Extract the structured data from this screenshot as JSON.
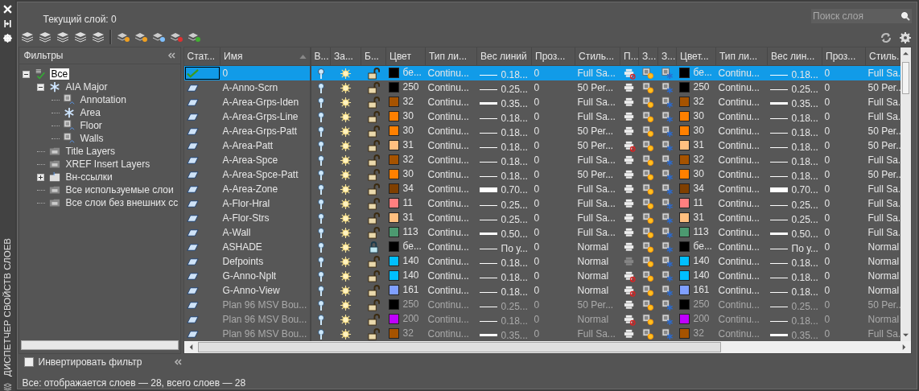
{
  "palette_title": "ДИСПЕТЧЕР СВОЙСТВ СЛОЕВ",
  "current_layer": "Текущий слой: 0",
  "search": {
    "placeholder": "Поиск слоя"
  },
  "filters": {
    "title": "Фильтры",
    "tree": [
      {
        "label": "Все",
        "kind": "all",
        "selected": true,
        "expanded": true,
        "children": [
          {
            "label": "AIA Major",
            "kind": "group",
            "selected": false,
            "expanded": true,
            "children": [
              {
                "label": "Annotation",
                "kind": "property",
                "selected": false
              },
              {
                "label": "Area",
                "kind": "group",
                "selected": false
              },
              {
                "label": "Floor",
                "kind": "property",
                "selected": false
              },
              {
                "label": "Walls",
                "kind": "property",
                "selected": false
              }
            ]
          },
          {
            "label": "Title Layers",
            "kind": "folder",
            "selected": false
          },
          {
            "label": "XREF Insert Layers",
            "kind": "folder",
            "selected": false
          },
          {
            "label": "Вн-ссылки",
            "kind": "xref",
            "selected": false,
            "expanded": false
          },
          {
            "label": "Все используемые слои",
            "kind": "folder",
            "selected": false
          },
          {
            "label": "Все слои без внешних сс",
            "kind": "folder",
            "selected": false
          }
        ]
      }
    ],
    "invert": {
      "label": "Инвертировать фильтр",
      "checked": false
    }
  },
  "table": {
    "columns": [
      "Стат...",
      "Имя",
      "В...",
      "За...",
      "Б...",
      "Цвет",
      "Тип ли...",
      "Вес линий",
      "Проз...",
      "Стиль...",
      "П...",
      "З...",
      "З...",
      "Цвет...",
      "Тип ли...",
      "Вес лин...",
      "Проз...",
      "Стиль."
    ],
    "rows": [
      {
        "name": "0",
        "kind": "thin",
        "selected": true,
        "current": true,
        "dimmed": false,
        "on": true,
        "frozen": false,
        "locked": false,
        "color": "#000000",
        "color_name": "бе...",
        "linetype": "Continu...",
        "lineweight": "0.18...",
        "transparency": "0",
        "plot_style": "Full Sa...",
        "plot": false,
        "plot_disabled": false,
        "vp_color_name": "бе...",
        "vp_linetype": "Continu...",
        "vp_lineweight": "0.18...",
        "vp_transparency": "0",
        "vp_plot_style": "Full Sa."
      },
      {
        "name": "A-Anno-Scrn",
        "kind": "thin",
        "selected": false,
        "current": false,
        "dimmed": false,
        "on": true,
        "frozen": false,
        "locked": false,
        "color": "#000000",
        "color_name": "250",
        "linetype": "Continu...",
        "lineweight": "0.25...",
        "transparency": "0",
        "plot_style": "50 Per...",
        "plot": true,
        "plot_disabled": false,
        "vp_color_name": "250",
        "vp_linetype": "Continu...",
        "vp_lineweight": "0.25...",
        "vp_transparency": "0",
        "vp_plot_style": "50 Per.."
      },
      {
        "name": "A-Area-Grps-Iden",
        "kind": "bold",
        "selected": false,
        "current": false,
        "dimmed": false,
        "on": true,
        "frozen": false,
        "locked": false,
        "color": "#a65300",
        "color_name": "32",
        "linetype": "Continu...",
        "lineweight": "0.35...",
        "transparency": "0",
        "plot_style": "Full Sa...",
        "plot": true,
        "plot_disabled": false,
        "vp_color_name": "32",
        "vp_linetype": "Continu...",
        "vp_lineweight": "0.35...",
        "vp_transparency": "0",
        "vp_plot_style": "Full Sa."
      },
      {
        "name": "A-Area-Grps-Line",
        "kind": "thin",
        "selected": false,
        "current": false,
        "dimmed": false,
        "on": true,
        "frozen": false,
        "locked": false,
        "color": "#ff8000",
        "color_name": "30",
        "linetype": "Continu...",
        "lineweight": "0.18...",
        "transparency": "0",
        "plot_style": "Full Sa...",
        "plot": true,
        "plot_disabled": false,
        "vp_color_name": "30",
        "vp_linetype": "Continu...",
        "vp_lineweight": "0.18...",
        "vp_transparency": "0",
        "vp_plot_style": "Full Sa."
      },
      {
        "name": "A-Area-Grps-Patt",
        "kind": "thin",
        "selected": false,
        "current": false,
        "dimmed": false,
        "on": true,
        "frozen": false,
        "locked": false,
        "color": "#ff8000",
        "color_name": "30",
        "linetype": "Continu...",
        "lineweight": "0.18...",
        "transparency": "0",
        "plot_style": "50 Per...",
        "plot": true,
        "plot_disabled": false,
        "vp_color_name": "30",
        "vp_linetype": "Continu...",
        "vp_lineweight": "0.18...",
        "vp_transparency": "0",
        "vp_plot_style": "50 Per.."
      },
      {
        "name": "A-Area-Patt",
        "kind": "thin",
        "selected": false,
        "current": false,
        "dimmed": false,
        "on": true,
        "frozen": false,
        "locked": false,
        "color": "#ffbf80",
        "color_name": "31",
        "linetype": "Continu...",
        "lineweight": "0.18...",
        "transparency": "0",
        "plot_style": "50 Per...",
        "plot": false,
        "plot_disabled": false,
        "vp_color_name": "31",
        "vp_linetype": "Continu...",
        "vp_lineweight": "0.18...",
        "vp_transparency": "0",
        "vp_plot_style": "50 Per.."
      },
      {
        "name": "A-Area-Spce",
        "kind": "thin",
        "selected": false,
        "current": false,
        "dimmed": false,
        "on": true,
        "frozen": false,
        "locked": false,
        "color": "#a65300",
        "color_name": "32",
        "linetype": "Continu...",
        "lineweight": "0.18...",
        "transparency": "0",
        "plot_style": "Full Sa...",
        "plot": true,
        "plot_disabled": false,
        "vp_color_name": "32",
        "vp_linetype": "Continu...",
        "vp_lineweight": "0.18...",
        "vp_transparency": "0",
        "vp_plot_style": "Full Sa."
      },
      {
        "name": "A-Area-Spce-Patt",
        "kind": "thin",
        "selected": false,
        "current": false,
        "dimmed": false,
        "on": true,
        "frozen": false,
        "locked": false,
        "color": "#ff8000",
        "color_name": "30",
        "linetype": "Continu...",
        "lineweight": "0.18...",
        "transparency": "0",
        "plot_style": "50 Per...",
        "plot": true,
        "plot_disabled": false,
        "vp_color_name": "30",
        "vp_linetype": "Continu...",
        "vp_lineweight": "0.18...",
        "vp_transparency": "0",
        "vp_plot_style": "50 Per.."
      },
      {
        "name": "A-Area-Zone",
        "kind": "heavy",
        "selected": false,
        "current": false,
        "dimmed": false,
        "on": true,
        "frozen": false,
        "locked": false,
        "color": "#7f3f00",
        "color_name": "34",
        "linetype": "Continu...",
        "lineweight": "0.70...",
        "transparency": "0",
        "plot_style": "Full Sa...",
        "plot": true,
        "plot_disabled": false,
        "vp_color_name": "34",
        "vp_linetype": "Continu...",
        "vp_lineweight": "0.70...",
        "vp_transparency": "0",
        "vp_plot_style": "Full Sa."
      },
      {
        "name": "A-Flor-Hral",
        "kind": "thin",
        "selected": false,
        "current": false,
        "dimmed": false,
        "on": true,
        "frozen": false,
        "locked": false,
        "color": "#ff7f7f",
        "color_name": "11",
        "linetype": "Continu...",
        "lineweight": "0.25...",
        "transparency": "0",
        "plot_style": "Full Sa...",
        "plot": true,
        "plot_disabled": false,
        "vp_color_name": "11",
        "vp_linetype": "Continu...",
        "vp_lineweight": "0.25...",
        "vp_transparency": "0",
        "vp_plot_style": "Full Sa."
      },
      {
        "name": "A-Flor-Strs",
        "kind": "thin",
        "selected": false,
        "current": false,
        "dimmed": false,
        "on": true,
        "frozen": false,
        "locked": false,
        "color": "#ffbf7f",
        "color_name": "31",
        "linetype": "Continu...",
        "lineweight": "0.25...",
        "transparency": "0",
        "plot_style": "Full Sa...",
        "plot": true,
        "plot_disabled": false,
        "vp_color_name": "31",
        "vp_linetype": "Continu...",
        "vp_lineweight": "0.25...",
        "vp_transparency": "0",
        "vp_plot_style": "Full Sa."
      },
      {
        "name": "A-Wall",
        "kind": "bold",
        "selected": false,
        "current": false,
        "dimmed": false,
        "on": true,
        "frozen": false,
        "locked": false,
        "color": "#4c9970",
        "color_name": "113",
        "linetype": "Continu...",
        "lineweight": "0.50...",
        "transparency": "0",
        "plot_style": "Full Sa...",
        "plot": true,
        "plot_disabled": false,
        "vp_color_name": "113",
        "vp_linetype": "Continu...",
        "vp_lineweight": "0.50...",
        "vp_transparency": "0",
        "vp_plot_style": "Full Sa."
      },
      {
        "name": "ASHADE",
        "kind": "thin",
        "selected": false,
        "current": false,
        "dimmed": false,
        "on": true,
        "frozen": false,
        "locked": true,
        "color": "#000000",
        "color_name": "бе...",
        "linetype": "Continu...",
        "lineweight": "По у...",
        "transparency": "0",
        "plot_style": "Normal",
        "plot": true,
        "plot_disabled": false,
        "vp_color_name": "бе...",
        "vp_linetype": "Continu...",
        "vp_lineweight": "По у...",
        "vp_transparency": "0",
        "vp_plot_style": "Normal"
      },
      {
        "name": "Defpoints",
        "kind": "thin",
        "selected": false,
        "current": false,
        "dimmed": false,
        "on": true,
        "frozen": false,
        "locked": false,
        "color": "#00bfff",
        "color_name": "140",
        "linetype": "Continu...",
        "lineweight": "0.18...",
        "transparency": "0",
        "plot_style": "Normal",
        "plot": false,
        "plot_disabled": true,
        "vp_color_name": "140",
        "vp_linetype": "Continu...",
        "vp_lineweight": "0.18...",
        "vp_transparency": "0",
        "vp_plot_style": "Normal"
      },
      {
        "name": "G-Anno-Nplt",
        "kind": "thin",
        "selected": false,
        "current": false,
        "dimmed": false,
        "on": true,
        "frozen": false,
        "locked": false,
        "color": "#00bfff",
        "color_name": "140",
        "linetype": "Continu...",
        "lineweight": "0.18...",
        "transparency": "0",
        "plot_style": "Normal",
        "plot": false,
        "plot_disabled": false,
        "vp_color_name": "140",
        "vp_linetype": "Continu...",
        "vp_lineweight": "0.18...",
        "vp_transparency": "0",
        "vp_plot_style": "Normal"
      },
      {
        "name": "G-Anno-View",
        "kind": "thin",
        "selected": false,
        "current": false,
        "dimmed": false,
        "on": true,
        "frozen": false,
        "locked": false,
        "color": "#7f9fff",
        "color_name": "161",
        "linetype": "Continu...",
        "lineweight": "0.18...",
        "transparency": "0",
        "plot_style": "Normal",
        "plot": false,
        "plot_disabled": false,
        "vp_color_name": "161",
        "vp_linetype": "Continu...",
        "vp_lineweight": "0.18...",
        "vp_transparency": "0",
        "vp_plot_style": "Normal"
      },
      {
        "name": "Plan 96 MSV Bou...",
        "kind": "thin",
        "selected": false,
        "current": false,
        "dimmed": true,
        "on": true,
        "frozen": false,
        "locked": false,
        "color": "#000000",
        "color_name": "250",
        "linetype": "Continu...",
        "lineweight": "0.25...",
        "transparency": "0",
        "plot_style": "50 Per...",
        "plot": true,
        "plot_disabled": false,
        "vp_color_name": "250",
        "vp_linetype": "Continu...",
        "vp_lineweight": "0.25...",
        "vp_transparency": "0",
        "vp_plot_style": "50 Per.."
      },
      {
        "name": "Plan 96 MSV Bou...",
        "kind": "thin",
        "selected": false,
        "current": false,
        "dimmed": true,
        "on": true,
        "frozen": false,
        "locked": false,
        "color": "#bf00ff",
        "color_name": "200",
        "linetype": "Continu...",
        "lineweight": "0.18...",
        "transparency": "0",
        "plot_style": "Normal",
        "plot": false,
        "plot_disabled": false,
        "vp_color_name": "200",
        "vp_linetype": "Continu...",
        "vp_lineweight": "0.18...",
        "vp_transparency": "0",
        "vp_plot_style": "Normal"
      },
      {
        "name": "Plan 96 MSV Bou...",
        "kind": "bold",
        "selected": false,
        "current": false,
        "dimmed": true,
        "on": true,
        "frozen": false,
        "locked": false,
        "color": "#a65300",
        "color_name": "32",
        "linetype": "Continu...",
        "lineweight": "0.35...",
        "transparency": "0",
        "plot_style": "Full Sa...",
        "plot": true,
        "plot_disabled": false,
        "vp_color_name": "32",
        "vp_linetype": "Continu...",
        "vp_lineweight": "0.35...",
        "vp_transparency": "0",
        "vp_plot_style": "Full Sa."
      }
    ]
  },
  "status_bar": "Все: отображается слоев — 28, всего слоев — 28"
}
